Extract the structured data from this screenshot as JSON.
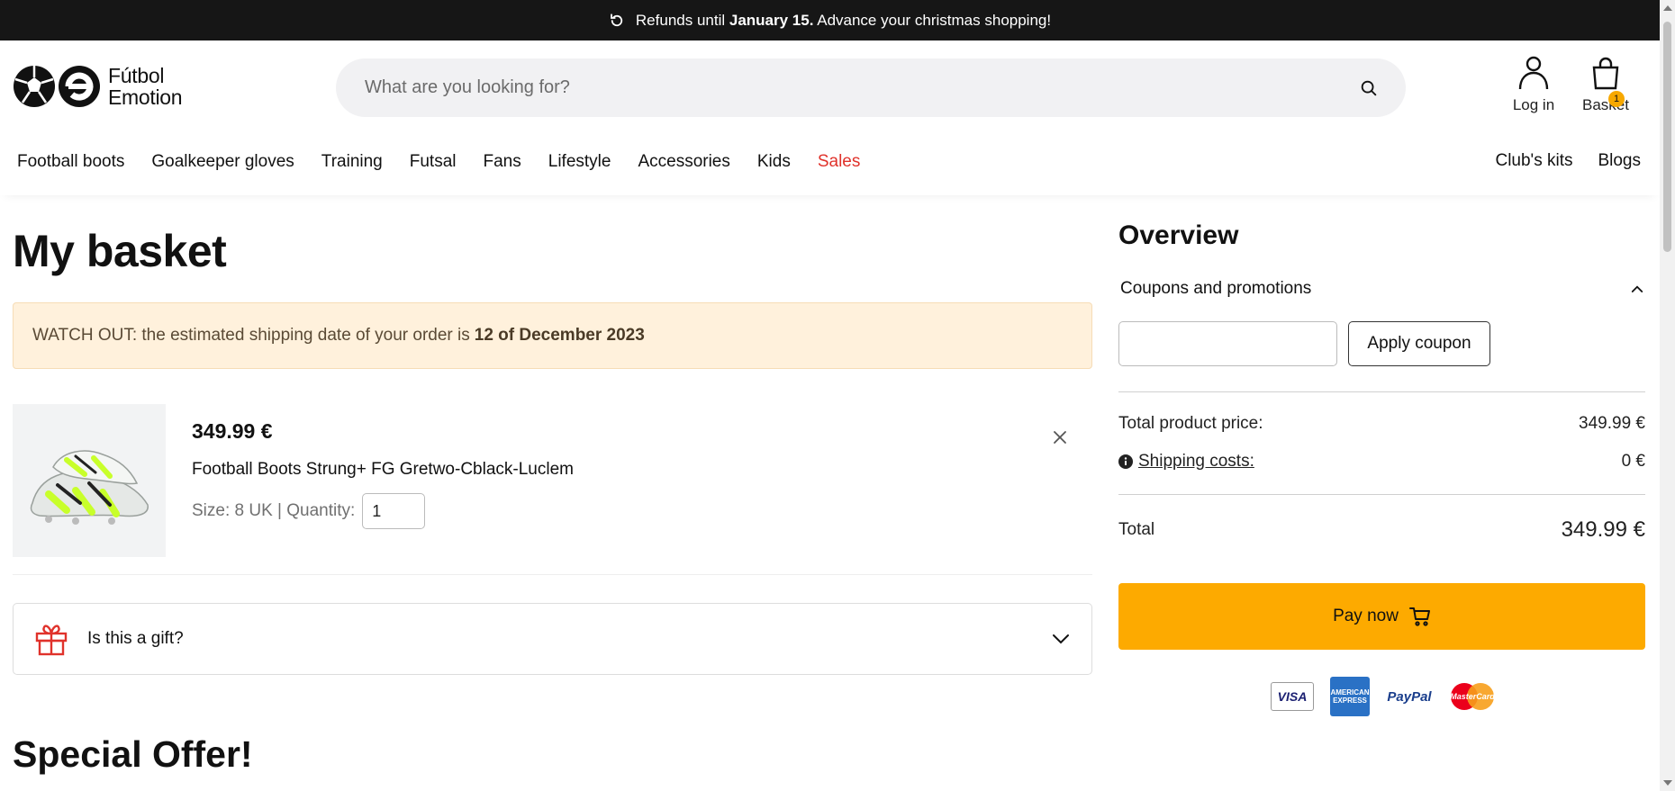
{
  "announcement": {
    "prefix": "Refunds until",
    "highlight": "January 15.",
    "suffix": "Advance your christmas shopping!",
    "icon": "undo-icon"
  },
  "header": {
    "logo_line1": "Fútbol",
    "logo_line2": "Emotion",
    "search_placeholder": "What are you looking for?",
    "login_label": "Log in",
    "basket_label": "Basket",
    "basket_count": "1"
  },
  "nav": {
    "items": [
      {
        "label": "Football boots"
      },
      {
        "label": "Goalkeeper gloves"
      },
      {
        "label": "Training"
      },
      {
        "label": "Futsal"
      },
      {
        "label": "Fans"
      },
      {
        "label": "Lifestyle"
      },
      {
        "label": "Accessories"
      },
      {
        "label": "Kids"
      },
      {
        "label": "Sales",
        "color": "#e0322b"
      }
    ],
    "right": [
      {
        "label": "Club's kits"
      },
      {
        "label": "Blogs"
      }
    ]
  },
  "main": {
    "title": "My basket",
    "warning_text": "WATCH OUT: the estimated shipping date of your order is",
    "warning_date": "12 of December 2023",
    "item": {
      "price": "349.99 €",
      "name": "Football Boots Strung+ FG Gretwo-Cblack-Luclem",
      "size_label": "Size: 8 UK | Quantity:",
      "quantity": "1"
    },
    "gift_label": "Is this a gift?",
    "special_title": "Special Offer!"
  },
  "overview": {
    "title": "Overview",
    "coupons_label": "Coupons and promotions",
    "apply_label": "Apply coupon",
    "coupon_value": "",
    "product_price_label": "Total product price:",
    "product_price_value": "349.99 €",
    "shipping_label": "Shipping costs:",
    "shipping_value": "0 €",
    "total_label": "Total",
    "total_value": "349.99 €",
    "pay_label": "Pay now",
    "payment_methods": [
      "VISA",
      "AMERICAN EXPRESS",
      "PayPal",
      "MasterCard"
    ]
  },
  "colors": {
    "accent": "#fdaa00",
    "sales": "#e0322b",
    "warning_bg": "#fff1dc",
    "topbar_bg": "#161616"
  }
}
